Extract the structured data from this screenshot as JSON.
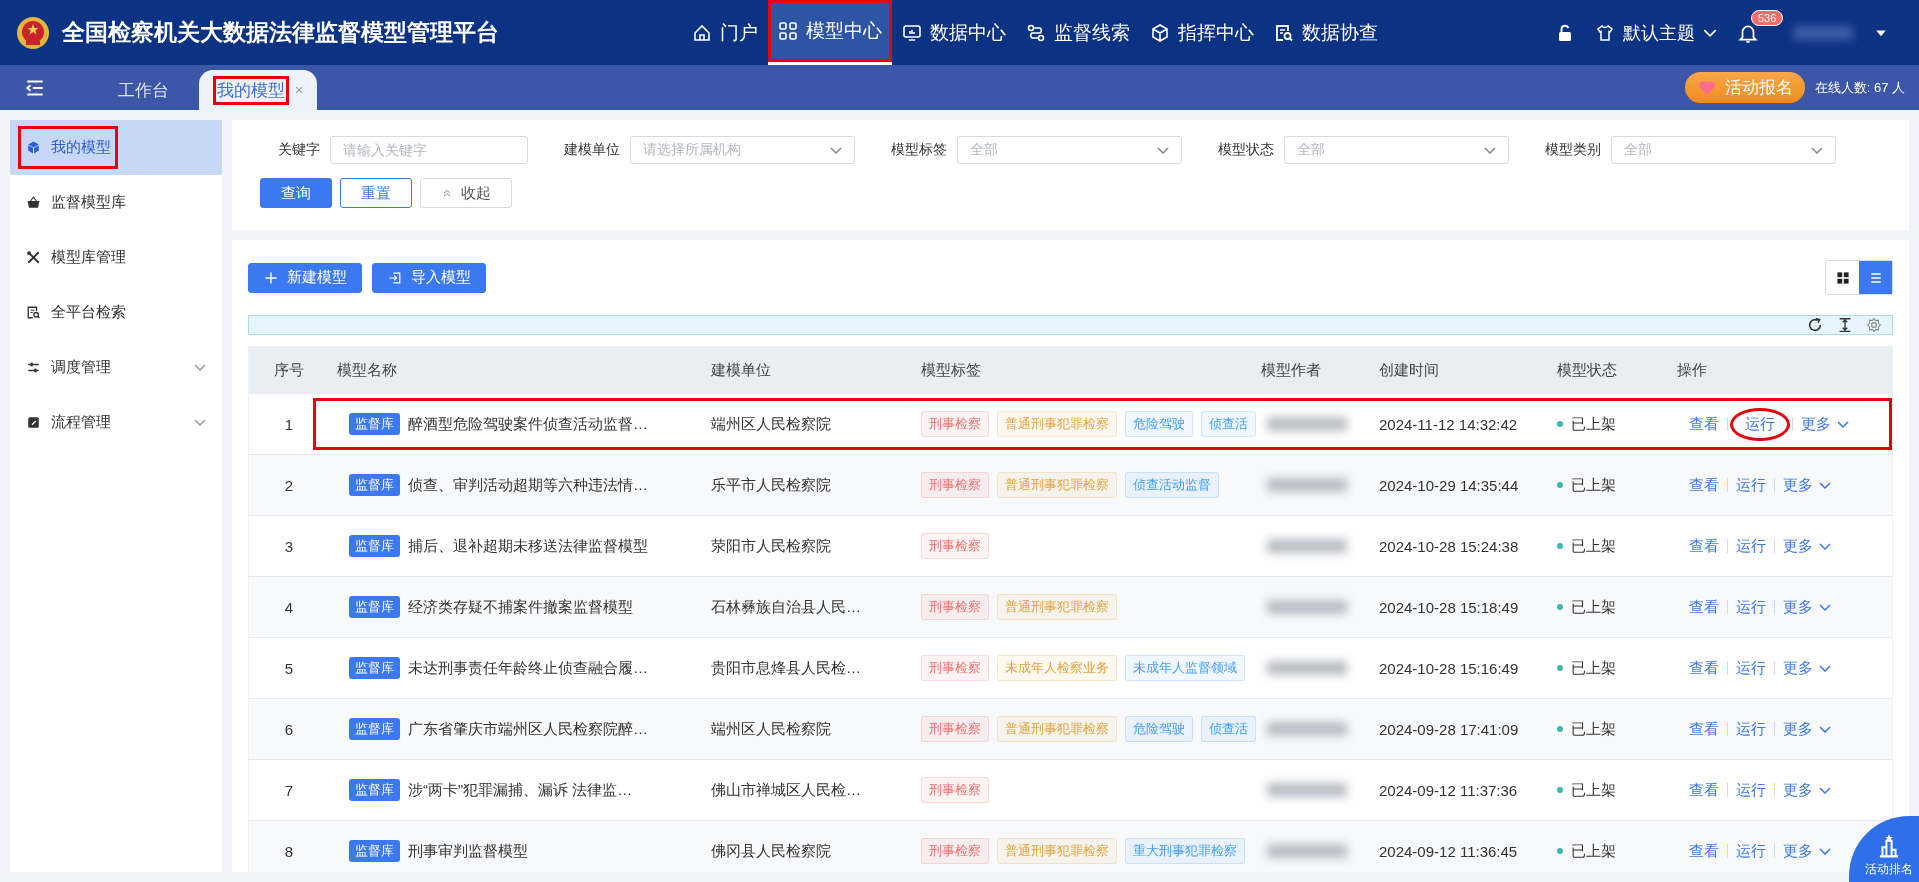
{
  "header": {
    "title": "全国检察机关大数据法律监督模型管理平台",
    "nav": [
      {
        "label": "门户",
        "selected": false,
        "highlighted": false
      },
      {
        "label": "模型中心",
        "selected": true,
        "highlighted": true
      },
      {
        "label": "数据中心",
        "selected": false,
        "highlighted": false
      },
      {
        "label": "监督线索",
        "selected": false,
        "highlighted": false
      },
      {
        "label": "指挥中心",
        "selected": false,
        "highlighted": false
      },
      {
        "label": "数据协查",
        "selected": false,
        "highlighted": false
      }
    ],
    "theme": "默认主题",
    "notifications": "536"
  },
  "tab_bar": {
    "tabs": [
      {
        "label": "工作台",
        "selected": false,
        "closable": false,
        "highlighted": false
      },
      {
        "label": "我的模型",
        "selected": true,
        "closable": true,
        "highlighted": true
      }
    ],
    "close": "×",
    "event_button": "活动报名",
    "online": "在线人数: 67 人"
  },
  "sidebar": {
    "items": [
      {
        "label": "我的模型",
        "selected": true,
        "highlighted": true,
        "expandable": false
      },
      {
        "label": "监督模型库",
        "selected": false,
        "highlighted": false,
        "expandable": false
      },
      {
        "label": "模型库管理",
        "selected": false,
        "highlighted": false,
        "expandable": false
      },
      {
        "label": "全平台检索",
        "selected": false,
        "highlighted": false,
        "expandable": false
      },
      {
        "label": "调度管理",
        "selected": false,
        "highlighted": false,
        "expandable": true
      },
      {
        "label": "流程管理",
        "selected": false,
        "highlighted": false,
        "expandable": true
      }
    ]
  },
  "filters": [
    {
      "label": "关键字",
      "kind": "input",
      "placeholder": "请输入关键字"
    },
    {
      "label": "建模单位",
      "kind": "select",
      "placeholder": "请选择所属机构"
    },
    {
      "label": "模型标签",
      "kind": "select",
      "placeholder": "全部"
    },
    {
      "label": "模型状态",
      "kind": "select",
      "placeholder": "全部"
    },
    {
      "label": "模型类别",
      "kind": "select",
      "placeholder": "全部"
    }
  ],
  "filter_buttons": [
    {
      "label": "查询",
      "kind": "primary"
    },
    {
      "label": "重置",
      "kind": "outline"
    },
    {
      "label": "收起",
      "kind": "collapse"
    }
  ],
  "toolbar": {
    "buttons": [
      {
        "label": "新建模型"
      },
      {
        "label": "导入模型"
      }
    ],
    "views": [
      {
        "kind": "grid",
        "selected": false
      },
      {
        "kind": "list",
        "selected": true
      }
    ]
  },
  "table": {
    "columns": [
      "序号",
      "模型名称",
      "建模单位",
      "模型标签",
      "模型作者",
      "创建时间",
      "模型状态",
      "操作"
    ],
    "rows": [
      {
        "index": "1",
        "badge": "监督库",
        "name": "醉酒型危险驾驶案件侦查活动监督…",
        "unit": "端州区人民检察院",
        "tags": [
          {
            "label": "刑事检察",
            "color": "#f56c6c"
          },
          {
            "label": "普通刑事犯罪检察",
            "color": "#e6a23c"
          },
          {
            "label": "危险驾驶",
            "color": "#409eff"
          },
          {
            "label": "侦查活",
            "color": "#409eff"
          }
        ],
        "time": "2024-11-12 14:32:42",
        "status": "已上架",
        "actions": [
          {
            "label": "查看",
            "circled": false
          },
          {
            "label": "运行",
            "circled": true
          },
          {
            "label": "更多",
            "circled": false
          }
        ],
        "highlighted": true
      },
      {
        "index": "2",
        "badge": "监督库",
        "name": "侦查、审判活动超期等六种违法情…",
        "unit": "乐平市人民检察院",
        "tags": [
          {
            "label": "刑事检察",
            "color": "#f56c6c"
          },
          {
            "label": "普通刑事犯罪检察",
            "color": "#e6a23c"
          },
          {
            "label": "侦查活动监督",
            "color": "#409eff"
          }
        ],
        "time": "2024-10-29 14:35:44",
        "status": "已上架",
        "actions": [
          {
            "label": "查看",
            "circled": false
          },
          {
            "label": "运行",
            "circled": false
          },
          {
            "label": "更多",
            "circled": false
          }
        ],
        "highlighted": false
      },
      {
        "index": "3",
        "badge": "监督库",
        "name": "捕后、退补超期未移送法律监督模型",
        "unit": "荥阳市人民检察院",
        "tags": [
          {
            "label": "刑事检察",
            "color": "#f56c6c"
          }
        ],
        "time": "2024-10-28 15:24:38",
        "status": "已上架",
        "actions": [
          {
            "label": "查看",
            "circled": false
          },
          {
            "label": "运行",
            "circled": false
          },
          {
            "label": "更多",
            "circled": false
          }
        ],
        "highlighted": false
      },
      {
        "index": "4",
        "badge": "监督库",
        "name": "经济类存疑不捕案件撤案监督模型",
        "unit": "石林彝族自治县人民…",
        "tags": [
          {
            "label": "刑事检察",
            "color": "#f56c6c"
          },
          {
            "label": "普通刑事犯罪检察",
            "color": "#e6a23c"
          }
        ],
        "time": "2024-10-28 15:18:49",
        "status": "已上架",
        "actions": [
          {
            "label": "查看",
            "circled": false
          },
          {
            "label": "运行",
            "circled": false
          },
          {
            "label": "更多",
            "circled": false
          }
        ],
        "highlighted": false
      },
      {
        "index": "5",
        "badge": "监督库",
        "name": "未达刑事责任年龄终止侦查融合履…",
        "unit": "贵阳市息烽县人民检…",
        "tags": [
          {
            "label": "刑事检察",
            "color": "#f56c6c"
          },
          {
            "label": "未成年人检察业务",
            "color": "#e6a23c"
          },
          {
            "label": "未成年人监督领域",
            "color": "#409eff"
          }
        ],
        "time": "2024-10-28 15:16:49",
        "status": "已上架",
        "actions": [
          {
            "label": "查看",
            "circled": false
          },
          {
            "label": "运行",
            "circled": false
          },
          {
            "label": "更多",
            "circled": false
          }
        ],
        "highlighted": false
      },
      {
        "index": "6",
        "badge": "监督库",
        "name": "广东省肇庆市端州区人民检察院醉…",
        "unit": "端州区人民检察院",
        "tags": [
          {
            "label": "刑事检察",
            "color": "#f56c6c"
          },
          {
            "label": "普通刑事犯罪检察",
            "color": "#e6a23c"
          },
          {
            "label": "危险驾驶",
            "color": "#409eff"
          },
          {
            "label": "侦查活",
            "color": "#409eff"
          }
        ],
        "time": "2024-09-28 17:41:09",
        "status": "已上架",
        "actions": [
          {
            "label": "查看",
            "circled": false
          },
          {
            "label": "运行",
            "circled": false
          },
          {
            "label": "更多",
            "circled": false
          }
        ],
        "highlighted": false
      },
      {
        "index": "7",
        "badge": "监督库",
        "name": "涉“两卡”犯罪漏捕、漏诉 法律监…",
        "unit": "佛山市禅城区人民检…",
        "tags": [
          {
            "label": "刑事检察",
            "color": "#f56c6c"
          }
        ],
        "time": "2024-09-12 11:37:36",
        "status": "已上架",
        "actions": [
          {
            "label": "查看",
            "circled": false
          },
          {
            "label": "运行",
            "circled": false
          },
          {
            "label": "更多",
            "circled": false
          }
        ],
        "highlighted": false
      },
      {
        "index": "8",
        "badge": "监督库",
        "name": "刑事审判监督模型",
        "unit": "佛冈县人民检察院",
        "tags": [
          {
            "label": "刑事检察",
            "color": "#f56c6c"
          },
          {
            "label": "普通刑事犯罪检察",
            "color": "#e6a23c"
          },
          {
            "label": "重大刑事犯罪检察",
            "color": "#409eff"
          }
        ],
        "time": "2024-09-12 11:36:45",
        "status": "已上架",
        "actions": [
          {
            "label": "查看",
            "circled": false
          },
          {
            "label": "运行",
            "circled": false
          },
          {
            "label": "更多",
            "circled": false
          }
        ],
        "highlighted": false
      }
    ]
  },
  "ranking_button": "活动排名"
}
